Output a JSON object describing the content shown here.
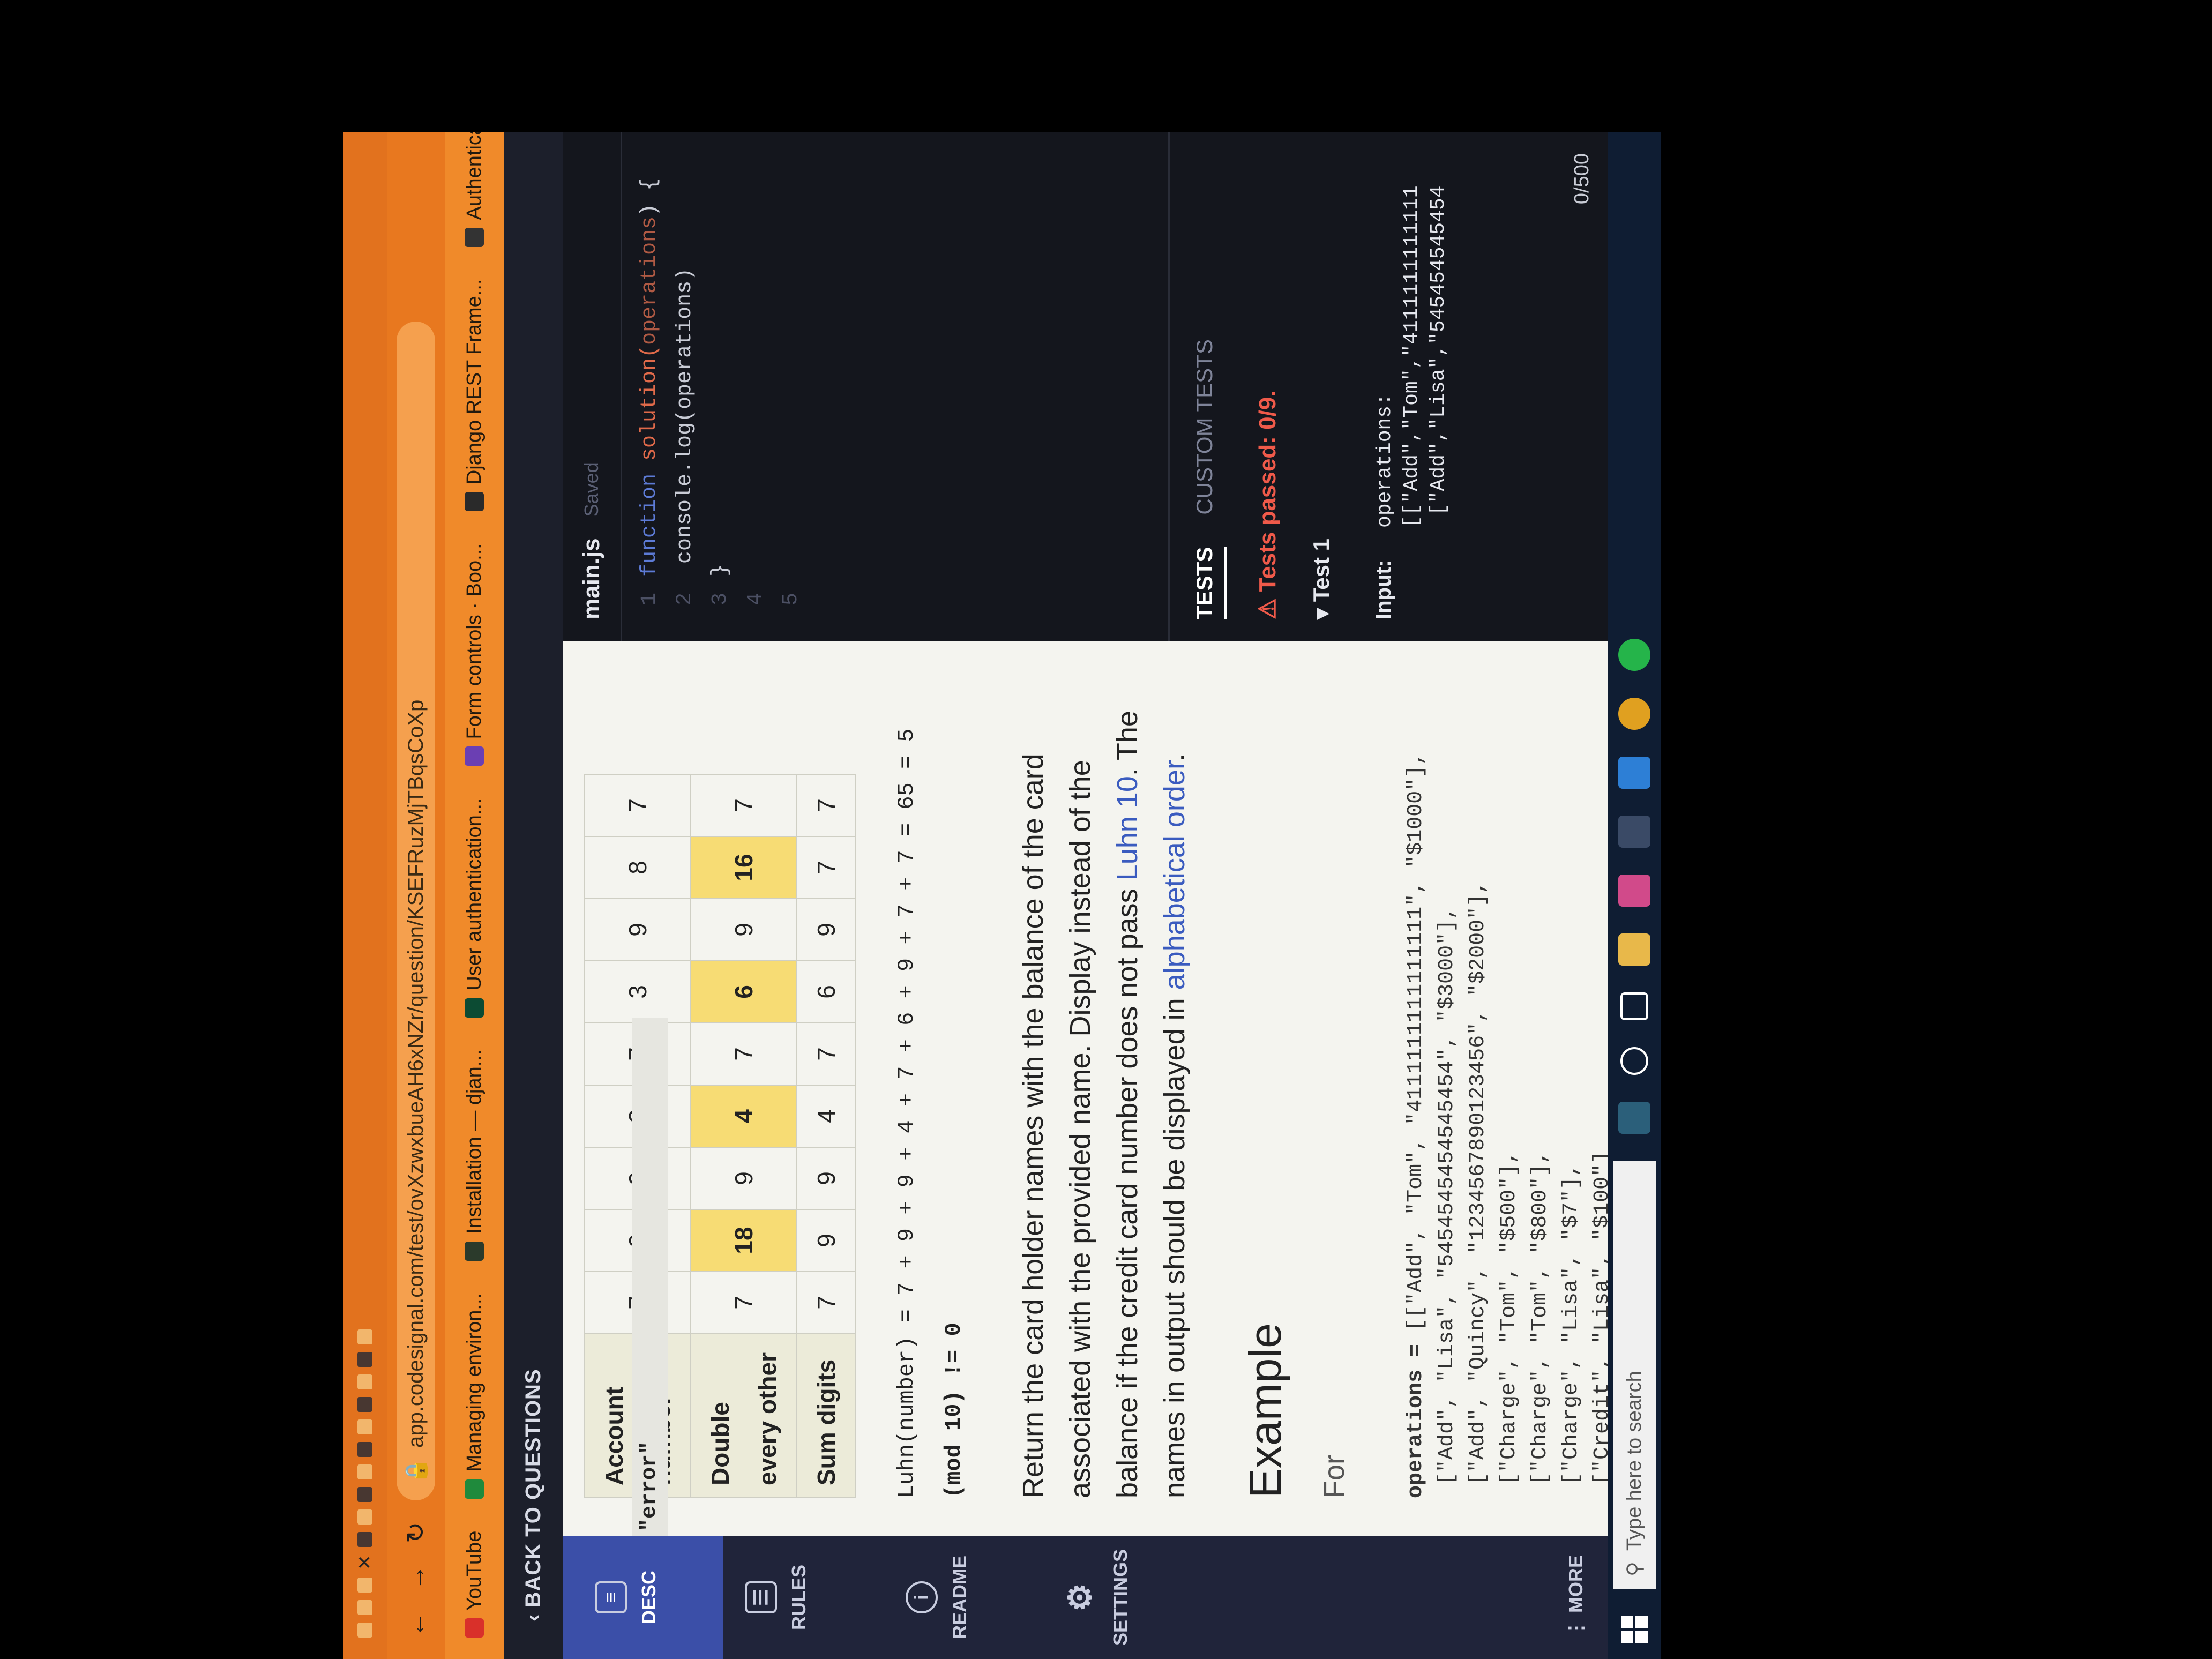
{
  "browser": {
    "url": "app.codesignal.com/test/ovXzwxbueAH6xNZr/question/KSEFRuzMjTBqsCoXp",
    "bookmarks": [
      {
        "label": "YouTube",
        "color": "#d9302a"
      },
      {
        "label": "Managing environ...",
        "color": "#1f8a3c"
      },
      {
        "label": "Installation — djan...",
        "color": "#2b3a2b"
      },
      {
        "label": "User authentication...",
        "color": "#0c4b33"
      },
      {
        "label": "Form controls · Boo...",
        "color": "#6b3fb3"
      },
      {
        "label": "Django REST Frame...",
        "color": "#2a2a2a"
      },
      {
        "label": "Authentication",
        "color": "#333333"
      }
    ]
  },
  "app": {
    "back_label": "BACK TO QUESTIONS",
    "nav": {
      "desc": "DESC",
      "rules": "RULES",
      "readme": "README",
      "settings": "SETTINGS",
      "more": "MORE"
    }
  },
  "description": {
    "table": {
      "rows": [
        {
          "header": "Account number",
          "cells": [
            "7",
            "9",
            "9",
            "2",
            "7",
            "3",
            "9",
            "8",
            "7"
          ],
          "highlight": []
        },
        {
          "header": "Double every other",
          "cells": [
            "7",
            "18",
            "9",
            "4",
            "7",
            "6",
            "9",
            "16",
            "7"
          ],
          "highlight": [
            1,
            3,
            5,
            7
          ]
        },
        {
          "header": "Sum digits",
          "cells": [
            "7",
            "9",
            "9",
            "4",
            "7",
            "6",
            "9",
            "7",
            "7"
          ],
          "highlight": []
        }
      ]
    },
    "formula_line1": "Luhn(number) = 7 + 9 + 9 + 4 + 7 + 6 + 9 + 7 + 7 = 65 = 5",
    "formula_line2": "(mod 10) != 0",
    "para_part1": "Return the card holder names with the balance of the card associated with the provided name. Display ",
    "para_code": "\"error\"",
    "para_part2": " instead of the balance if the credit card number does not pass ",
    "para_link": "Luhn 10",
    "para_part3": ". The names in output should be displayed in ",
    "para_link2": "alphabetical order",
    "para_end": ".",
    "example_heading": "Example",
    "for_label": "For",
    "operations_label": "operations =",
    "operations": "[[\"Add\", \"Tom\", \"4111111111111111\", \"$1000\"],\n [\"Add\", \"Lisa\", \"5454545454545454\", \"$3000\"],\n [\"Add\", \"Quincy\", \"1234567890123456\", \"$2000\"],\n [\"Charge\", \"Tom\", \"$500\"],\n [\"Charge\", \"Tom\", \"$800\"],\n [\"Charge\", \"Lisa\", \"$7\"],\n [\"Credit\", \"Lisa\", \"$100\"]"
  },
  "editor": {
    "filename": "main.js",
    "status": "Saved",
    "lines": [
      {
        "n": "1",
        "kw": "function",
        "fn": " solution(",
        "pa": "operations",
        "rest": ") {"
      },
      {
        "n": "2",
        "kw": "",
        "fn": "",
        "pa": "",
        "rest": "    console.log(operations)"
      },
      {
        "n": "3",
        "kw": "",
        "fn": "",
        "pa": "",
        "rest": "}"
      },
      {
        "n": "4",
        "kw": "",
        "fn": "",
        "pa": "",
        "rest": ""
      },
      {
        "n": "5",
        "kw": "",
        "fn": "",
        "pa": "",
        "rest": ""
      }
    ]
  },
  "tests": {
    "tab_tests": "TESTS",
    "tab_custom": "CUSTOM TESTS",
    "passed": "Tests passed: 0/9.",
    "test1": "Test 1",
    "input_label": "Input:",
    "input_value": "operations:\n[[\"Add\",\"Tom\",\"4111111111111\n [\"Add\",\"Lisa\",\"545454545454",
    "counter": "0/500"
  },
  "taskbar": {
    "search_placeholder": "Type here to search"
  }
}
